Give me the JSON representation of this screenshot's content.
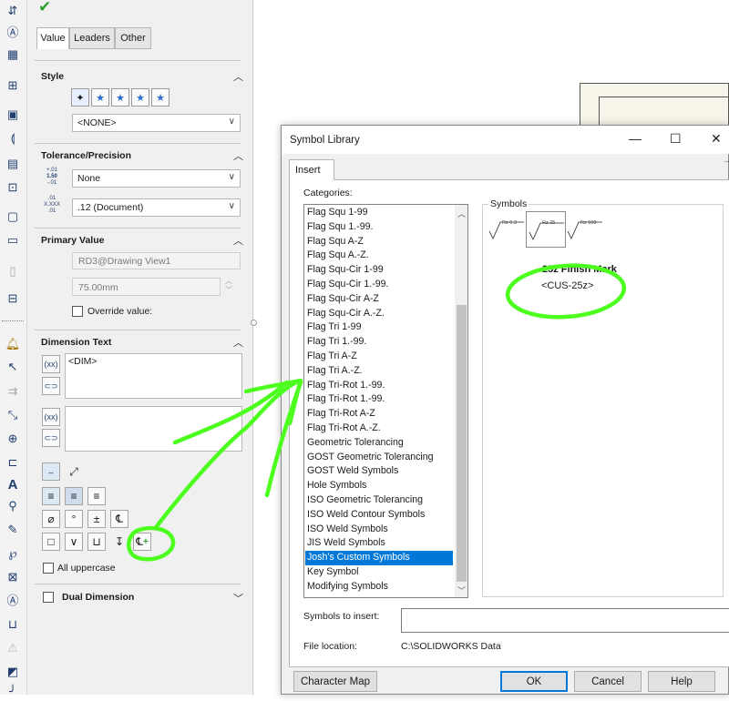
{
  "property_manager": {
    "ok_icon": "checkmark-icon",
    "tabs": [
      "Value",
      "Leaders",
      "Other"
    ],
    "style": {
      "title": "Style",
      "selected": "<NONE>",
      "buttons": [
        "apply-default-icon",
        "add-style-icon",
        "delete-style-icon",
        "save-style-icon",
        "load-style-icon"
      ]
    },
    "tolerance": {
      "title": "Tolerance/Precision",
      "tol_icon_label": [
        "+.01",
        "1.50",
        "-.01"
      ],
      "tol_value": "None",
      "prec_icon_label": [
        ".01",
        "X.XXX",
        ".01"
      ],
      "prec_value": ".12 (Document)"
    },
    "primary": {
      "title": "Primary Value",
      "name": "RD3@Drawing View1",
      "value": "75.00mm",
      "override_label": "Override value:"
    },
    "dim_text": {
      "title": "Dimension Text",
      "text_value": "<DIM>",
      "symbols_row1": [
        "⌀",
        "°",
        "±",
        "℄"
      ],
      "all_uppercase": "All uppercase",
      "dual_dimension": "Dual Dimension"
    }
  },
  "dialog": {
    "title": "Symbol Library",
    "window_controls": [
      "—",
      "☐",
      "✕"
    ],
    "tab": "Insert",
    "categories_label": "Categories:",
    "categories": [
      "Flag Squ 1-99",
      "Flag Squ 1.-99.",
      "Flag Squ A-Z",
      "Flag Squ A.-Z.",
      "Flag Squ-Cir 1-99",
      "Flag Squ-Cir 1.-99.",
      "Flag Squ-Cir A-Z",
      "Flag Squ-Cir A.-Z.",
      "Flag Tri 1-99",
      "Flag Tri 1.-99.",
      "Flag Tri A-Z",
      "Flag Tri A.-Z.",
      "Flag Tri-Rot 1.-99.",
      "Flag Tri-Rot 1.-99.",
      "Flag Tri-Rot A-Z",
      "Flag Tri-Rot A.-Z.",
      "Geometric Tolerancing",
      "GOST Geometric Tolerancing",
      "GOST Weld Symbols",
      "Hole Symbols",
      "ISO Geometric Tolerancing",
      "ISO Weld Contour Symbols",
      "ISO Weld Symbols",
      "JIS Weld Symbols",
      "Josh's Custom Symbols",
      "Key Symbol",
      "Modifying Symbols"
    ],
    "selected_category": "Josh's Custom Symbols",
    "symbols_label": "Symbols",
    "symbols": [
      {
        "label": "Rz 6.3"
      },
      {
        "label": "Rz 25"
      },
      {
        "label": "Rz 100"
      }
    ],
    "tooltip_title": "25z Finish Mark",
    "tooltip_code": "<CUS-25z>",
    "insert_label": "Symbols to insert:",
    "insert_value": "",
    "file_label": "File location:",
    "file_value": "C:\\SOLIDWORKS Data",
    "buttons": {
      "character_map": "Character Map",
      "ok": "OK",
      "cancel": "Cancel",
      "help": "Help"
    }
  },
  "colors": {
    "annotation": "#4cff1e",
    "selection": "#0078d7"
  }
}
